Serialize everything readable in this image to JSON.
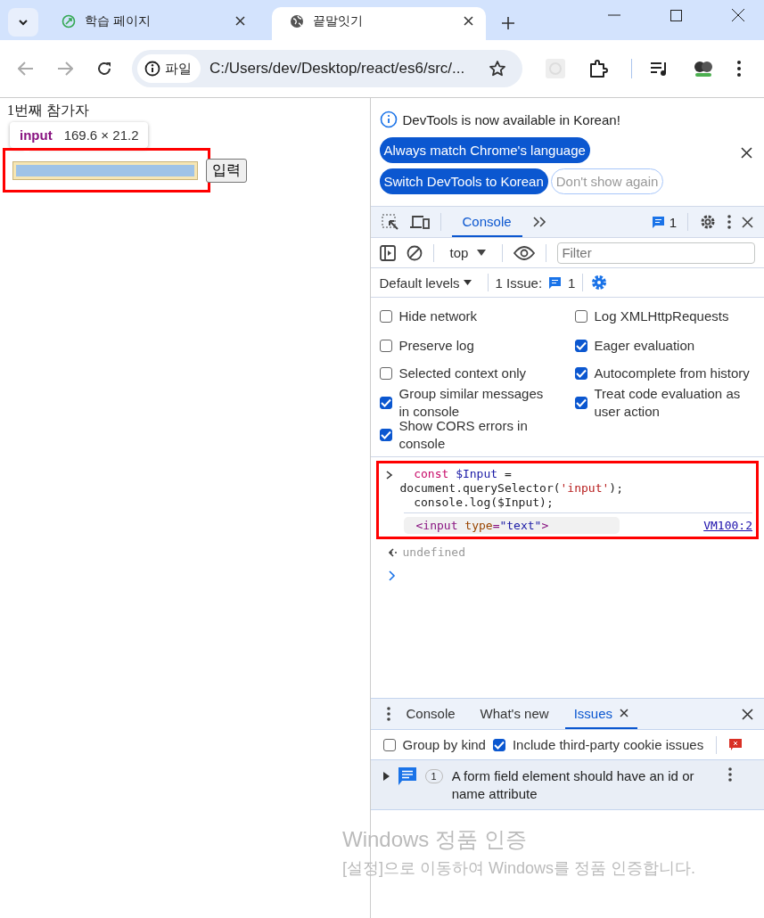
{
  "browser_tabs": [
    {
      "title": "학습 페이지",
      "selected": false
    },
    {
      "title": "끝말잇기",
      "selected": true
    }
  ],
  "address_bar": {
    "badge": "파일",
    "url": "C:/Users/dev/Desktop/react/es6/src/..."
  },
  "page": {
    "heading": "1번째 참가자",
    "button": "입력",
    "annotated": true
  },
  "inspect_tooltip": {
    "tag": "input",
    "size": "169.6 × 21.2"
  },
  "devtools": {
    "infobar": {
      "message": "DevTools is now available in Korean!",
      "buttons": [
        {
          "label": "Always match Chrome's language",
          "kind": "primary"
        },
        {
          "label": "Switch DevTools to Korean",
          "kind": "primary"
        },
        {
          "label": "Don't show again",
          "kind": "outline"
        }
      ]
    },
    "tabs": [
      {
        "label": "Console",
        "selected": true
      }
    ],
    "message_count": "1",
    "context": "top",
    "filter_placeholder": "Filter",
    "levels": "Default levels",
    "issues_label": "1 Issue:",
    "issues_count": "1",
    "settings": [
      {
        "label": "Hide network",
        "checked": false
      },
      {
        "label": "Log XMLHttpRequests",
        "checked": false
      },
      {
        "label": "Preserve log",
        "checked": false
      },
      {
        "label": "Eager evaluation",
        "checked": true
      },
      {
        "label": "Selected context only",
        "checked": false
      },
      {
        "label": "Autocomplete from history",
        "checked": true
      },
      {
        "label": "Group similar messages in console",
        "checked": true
      },
      {
        "label": "Treat code evaluation as user action",
        "checked": true
      },
      {
        "label": "Show CORS errors in console",
        "checked": true
      }
    ],
    "console": {
      "annotated": true,
      "input_lines": [
        [
          {
            "text": "  const",
            "kind": "keyword"
          },
          {
            "text": " $Input",
            "kind": "variable"
          },
          {
            "text": " =",
            "kind": "plain"
          }
        ],
        [
          {
            "text": "document.querySelector(",
            "kind": "plain"
          },
          {
            "text": "'input'",
            "kind": "string"
          },
          {
            "text": ");",
            "kind": "plain"
          }
        ],
        [
          {
            "text": "  console.log($Input);",
            "kind": "plain"
          }
        ]
      ],
      "output": [
        {
          "text": "<input",
          "kind": "tag"
        },
        {
          "text": " type",
          "kind": "attr"
        },
        {
          "text": "=",
          "kind": "tag"
        },
        {
          "text": "\"text\"",
          "kind": "value"
        },
        {
          "text": ">",
          "kind": "tag"
        }
      ],
      "source": "VM100:2",
      "result": "undefined"
    },
    "drawer": {
      "tabs": [
        {
          "label": "Console",
          "selected": false,
          "closable": false
        },
        {
          "label": "What's new",
          "selected": false,
          "closable": false
        },
        {
          "label": "Issues",
          "selected": true,
          "closable": true
        }
      ],
      "options": [
        {
          "label": "Group by kind",
          "checked": false
        },
        {
          "label": "Include third-party cookie issues",
          "checked": true
        }
      ],
      "issues": [
        {
          "count": "1",
          "text": "A form field element should have an id or name attribute"
        }
      ]
    }
  },
  "watermark": {
    "title": "Windows 정품 인증",
    "text": "[설정]으로 이동하여 Windows를 정품 인증합니다."
  }
}
